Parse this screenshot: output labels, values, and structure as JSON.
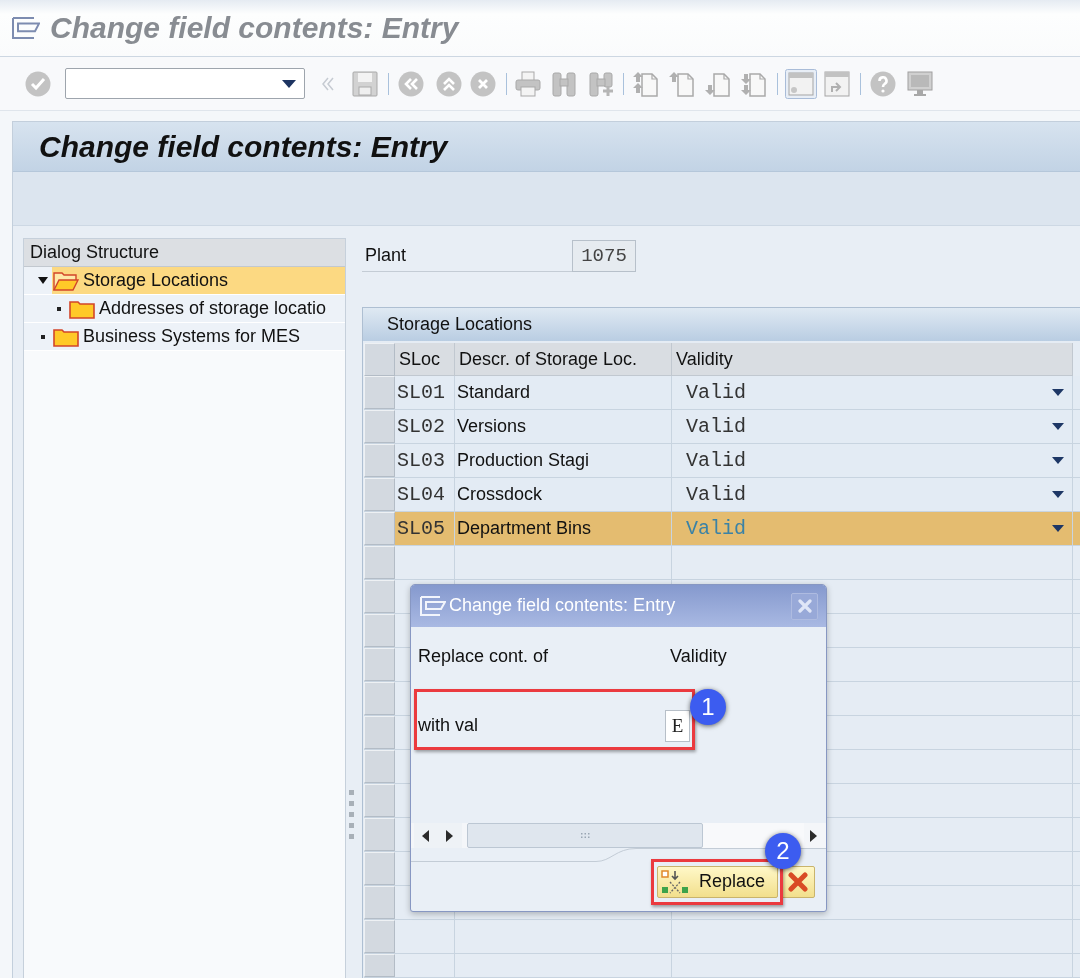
{
  "window": {
    "title": "Change field contents: Entry"
  },
  "screen": {
    "title": "Change field contents: Entry"
  },
  "dialog_structure": {
    "title": "Dialog Structure",
    "items": [
      {
        "label": "Storage Locations",
        "selected": true,
        "expanded": true,
        "children": [
          {
            "label": "Addresses of storage locatio",
            "selected": false
          }
        ]
      },
      {
        "label": "Business Systems for MES",
        "selected": false
      }
    ]
  },
  "plant": {
    "label": "Plant",
    "value": "1075"
  },
  "table": {
    "title": "Storage Locations",
    "columns": [
      "SLoc",
      "Descr. of Storage Loc.",
      "Validity"
    ],
    "rows": [
      {
        "sloc": "SL01",
        "description": "Standard",
        "validity": "Valid",
        "selected": false
      },
      {
        "sloc": "SL02",
        "description": "Versions",
        "validity": "Valid",
        "selected": false
      },
      {
        "sloc": "SL03",
        "description": "Production Stagi",
        "validity": "Valid",
        "selected": false
      },
      {
        "sloc": "SL04",
        "description": "Crossdock",
        "validity": "Valid",
        "selected": false
      },
      {
        "sloc": "SL05",
        "description": "Department Bins",
        "validity": "Valid",
        "selected": true
      }
    ]
  },
  "dialog": {
    "title": "Change field contents: Entry",
    "field_label": "Replace cont. of",
    "field_name": "Validity",
    "value_row": {
      "label": "with val",
      "value": "E",
      "callout": "1"
    },
    "replace_button": {
      "label": "Replace",
      "callout": "2"
    }
  }
}
